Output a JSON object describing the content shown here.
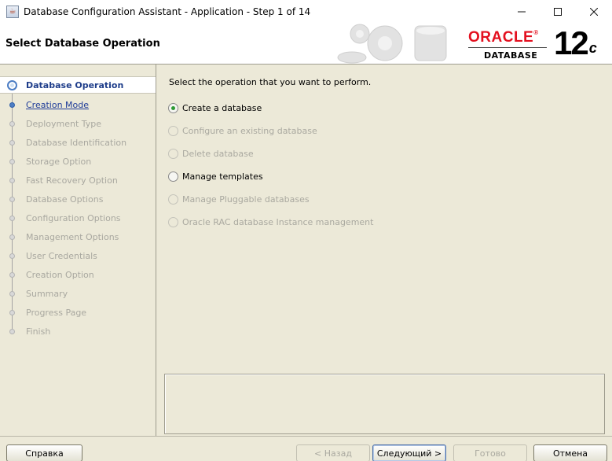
{
  "window": {
    "title": "Database Configuration Assistant - Application - Step 1 of 14",
    "controls": {
      "minimize": "—",
      "maximize": "☐",
      "close": "✕"
    }
  },
  "header": {
    "page_title": "Select Database Operation",
    "logo": {
      "brand": "ORACLE",
      "brand_mark": "®",
      "product": "DATABASE",
      "version": "12",
      "version_suffix": "c"
    }
  },
  "steps": [
    {
      "label": "Database Operation",
      "state": "active"
    },
    {
      "label": "Creation Mode",
      "state": "link"
    },
    {
      "label": "Deployment Type",
      "state": "disabled"
    },
    {
      "label": "Database Identification",
      "state": "disabled"
    },
    {
      "label": "Storage Option",
      "state": "disabled"
    },
    {
      "label": "Fast Recovery Option",
      "state": "disabled"
    },
    {
      "label": "Database Options",
      "state": "disabled"
    },
    {
      "label": "Configuration Options",
      "state": "disabled"
    },
    {
      "label": "Management Options",
      "state": "disabled"
    },
    {
      "label": "User Credentials",
      "state": "disabled"
    },
    {
      "label": "Creation Option",
      "state": "disabled"
    },
    {
      "label": "Summary",
      "state": "disabled"
    },
    {
      "label": "Progress Page",
      "state": "disabled"
    },
    {
      "label": "Finish",
      "state": "disabled"
    }
  ],
  "main": {
    "instruction": "Select the operation that you want to perform.",
    "options": [
      {
        "label": "Create a database",
        "checked": true,
        "enabled": true
      },
      {
        "label": "Configure an existing database",
        "checked": false,
        "enabled": false
      },
      {
        "label": "Delete database",
        "checked": false,
        "enabled": false
      },
      {
        "label": "Manage templates",
        "checked": false,
        "enabled": true
      },
      {
        "label": "Manage Pluggable databases",
        "checked": false,
        "enabled": false
      },
      {
        "label": "Oracle RAC database Instance management",
        "checked": false,
        "enabled": false
      }
    ]
  },
  "buttons": {
    "help": "Справка",
    "back": "< Назад",
    "next": "Следующий >",
    "finish": "Готово",
    "cancel": "Отмена"
  },
  "colors": {
    "active_step": "#1e3d8a",
    "link_step": "#1f3c99",
    "disabled_text": "#aaa9a0",
    "selected_radio": "#2d9a34",
    "oracle_red": "#e3101f",
    "panel_bg": "#ece9d8"
  }
}
